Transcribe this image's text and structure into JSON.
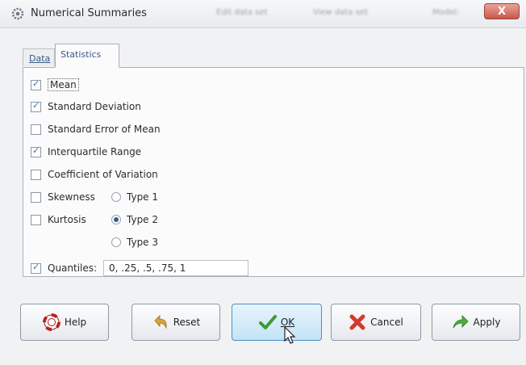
{
  "window": {
    "title": "Numerical Summaries",
    "taskbar_blurred": [
      "Edit data set",
      "View data set",
      "Model:"
    ],
    "close_glyph": "X"
  },
  "tabs": [
    {
      "label": "Data",
      "active": false
    },
    {
      "label": "Statistics",
      "active": true
    }
  ],
  "statistics": {
    "mean": {
      "label": "Mean",
      "checked": true
    },
    "sd": {
      "label": "Standard Deviation",
      "checked": true
    },
    "se": {
      "label": "Standard Error of Mean",
      "checked": false
    },
    "iqr": {
      "label": "Interquartile Range",
      "checked": true
    },
    "cv": {
      "label": "Coefficient of Variation",
      "checked": false
    },
    "skewness": {
      "label": "Skewness",
      "checked": false
    },
    "kurtosis": {
      "label": "Kurtosis",
      "checked": false
    },
    "types": [
      {
        "label": "Type 1",
        "selected": false
      },
      {
        "label": "Type 2",
        "selected": true
      },
      {
        "label": "Type 3",
        "selected": false
      }
    ],
    "quantiles": {
      "label": "Quantiles:",
      "checked": true,
      "value": "0, .25, .5, .75, 1"
    }
  },
  "buttons": {
    "help": "Help",
    "reset": "Reset",
    "ok": "OK",
    "cancel": "Cancel",
    "apply": "Apply"
  },
  "icons": {
    "app": "gear-icon",
    "help": "lifebuoy-icon",
    "reset": "undo-arrow-icon",
    "ok": "checkmark-icon",
    "cancel": "red-x-icon",
    "apply": "green-arrow-icon"
  }
}
